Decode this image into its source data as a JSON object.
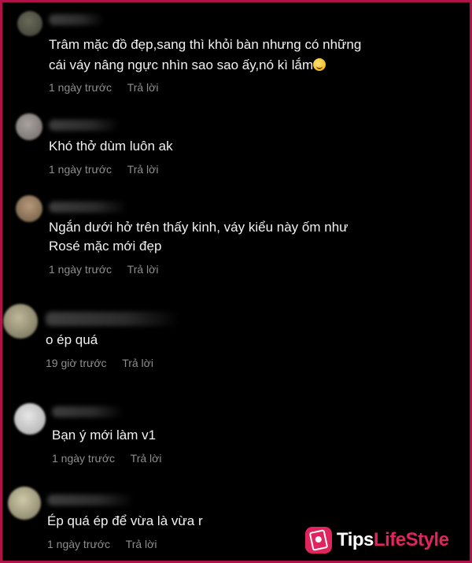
{
  "comments": [
    {
      "text_lines": [
        "Trâm mặc đồ đẹp,sang thì khỏi bàn nhưng có những",
        "cái váy nâng ngực nhìn sao sao ấy,nó kì lắm"
      ],
      "emoji": "grinning-sweat-emoji",
      "time": "1 ngày trước",
      "reply": "Trả lời"
    },
    {
      "text_lines": [
        "Khó thở dùm luôn ak"
      ],
      "time": "1 ngày trước",
      "reply": "Trả lời"
    },
    {
      "text_lines": [
        "Ngắn dưới hở trên thấy kinh, váy kiểu này ốm như",
        "Rosé mặc mới đẹp"
      ],
      "time": "1 ngày trước",
      "reply": "Trả lời"
    },
    {
      "text_lines": [
        "o ép quá"
      ],
      "time": "19 giờ trước",
      "reply": "Trả lời"
    },
    {
      "text_lines": [
        "Bạn ý mới làm v1"
      ],
      "time": "1 ngày trước",
      "reply": "Trả lời"
    },
    {
      "text_lines": [
        "Ép quá ép để vừa là vừa r"
      ],
      "time": "1 ngày trước",
      "reply": "Trả lời"
    }
  ],
  "watermark": {
    "part1": "Tips",
    "part2": "LifeStyle",
    "accent_color": "#e0245e",
    "frame_color": "#b0124a"
  }
}
